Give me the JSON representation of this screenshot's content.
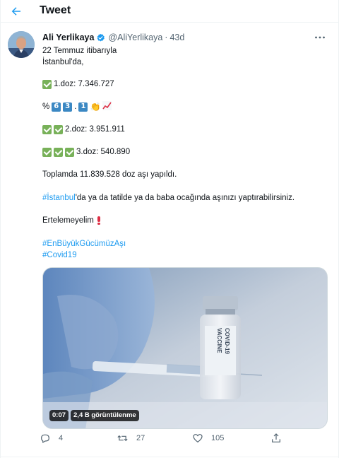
{
  "header": {
    "title": "Tweet",
    "back_icon": "arrow-left-icon"
  },
  "accent_color": "#1d9bf0",
  "tweet": {
    "author": {
      "display_name": "Ali Yerlikaya",
      "handle": "@AliYerlikaya",
      "verified": true,
      "verified_color": "#1d9bf0"
    },
    "separator": "·",
    "age": "43d",
    "lines": {
      "l1": "22 Temmuz itibarıyla",
      "l2": "İstanbul'da,",
      "dose1": "1.doz: 7.346.727",
      "percent_prefix": "%",
      "percent_digit1": "6",
      "percent_digit2": "3",
      "percent_dot": ".",
      "percent_digit3": "1",
      "dose2": "2.doz: 3.951.911",
      "dose3": "3.doz: 540.890",
      "total": "Toplamda 11.839.528 doz aşı yapıldı.",
      "istanbul_tag": "#İstanbul",
      "istanbul_rest": "'da ya da tatilde ya da baba ocağında aşınızı yaptırabilirsiniz.",
      "postpone": "Ertelemeyelim",
      "hashtag1": "#EnBüyükGücümüzAşı",
      "hashtag2": "#Covid19"
    },
    "media": {
      "vial_label_1": "COVID-19",
      "vial_label_2": "VACCINE",
      "duration": "0:07",
      "views": "2,4 B görüntülenme"
    },
    "stats": {
      "replies": "4",
      "retweets": "27",
      "likes": "105"
    }
  }
}
